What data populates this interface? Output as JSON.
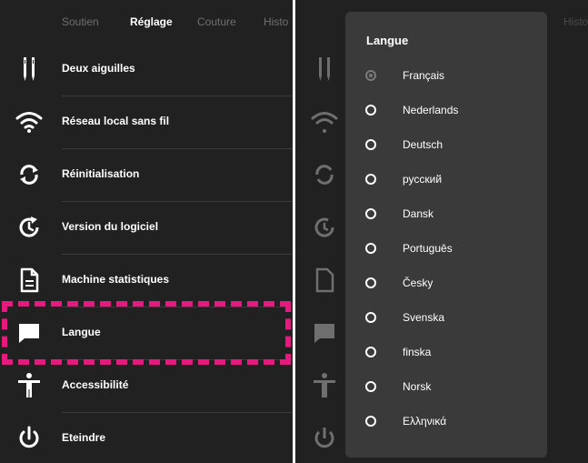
{
  "tabs": [
    {
      "label": "Soutien",
      "active": false
    },
    {
      "label": "Réglage",
      "active": true
    },
    {
      "label": "Couture",
      "active": false
    },
    {
      "label": "Histo",
      "active": false
    }
  ],
  "right_tab_fragment": "Histo",
  "menu": [
    {
      "label": "Deux aiguilles",
      "icon": "twin-needle-icon"
    },
    {
      "label": "Réseau local sans fil",
      "icon": "wifi-icon"
    },
    {
      "label": "Réinitialisation",
      "icon": "reset-icon"
    },
    {
      "label": "Version du logiciel",
      "icon": "software-version-icon"
    },
    {
      "label": "Machine statistiques",
      "icon": "document-icon"
    },
    {
      "label": "Langue",
      "icon": "chat-bubble-icon"
    },
    {
      "label": "Accessibilité",
      "icon": "accessibility-icon"
    },
    {
      "label": "Eteindre",
      "icon": "power-icon"
    }
  ],
  "highlight_item": "Langue",
  "highlight_color": "#e6197e",
  "dialog": {
    "title": "Langue",
    "options": [
      {
        "label": "Français",
        "selected": true
      },
      {
        "label": "Nederlands",
        "selected": false
      },
      {
        "label": "Deutsch",
        "selected": false
      },
      {
        "label": "русский",
        "selected": false
      },
      {
        "label": "Dansk",
        "selected": false
      },
      {
        "label": "Português",
        "selected": false
      },
      {
        "label": "Česky",
        "selected": false
      },
      {
        "label": "Svenska",
        "selected": false
      },
      {
        "label": "finska",
        "selected": false
      },
      {
        "label": "Norsk",
        "selected": false
      },
      {
        "label": "Ελληνικά",
        "selected": false
      }
    ]
  }
}
